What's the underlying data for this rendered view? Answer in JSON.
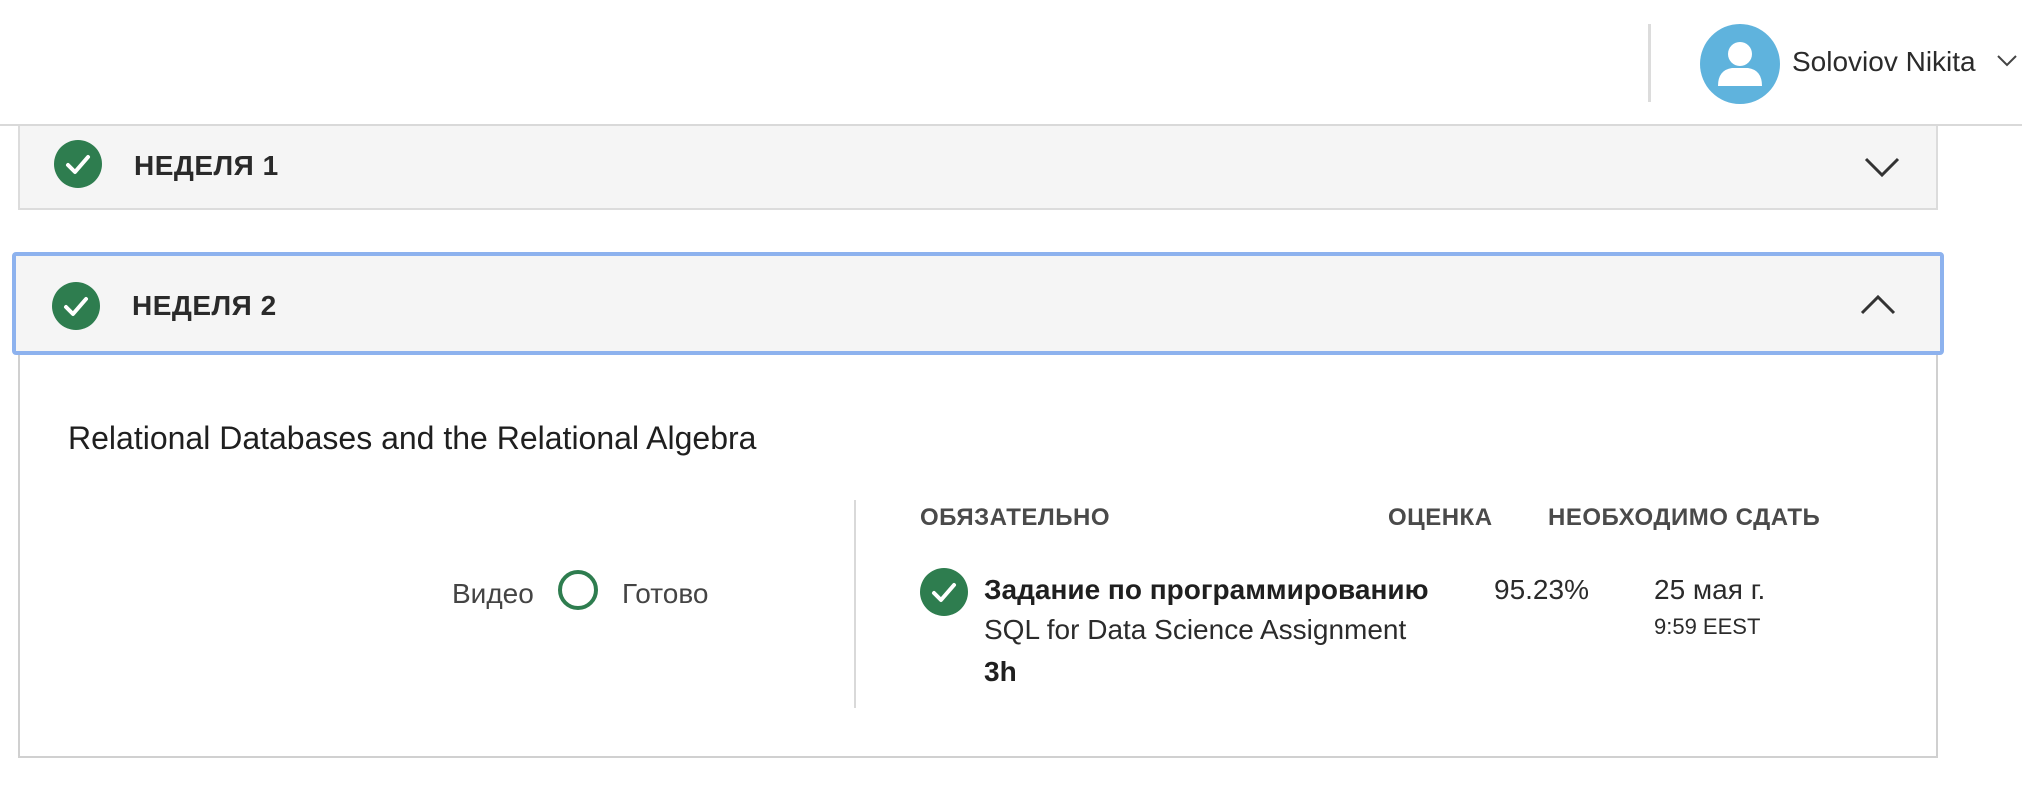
{
  "header": {
    "user_name": "Soloviov Nikita",
    "avatar_color": "#5fb3dd"
  },
  "weeks": [
    {
      "title": "НЕДЕЛЯ 1",
      "completed": true,
      "expanded": false
    },
    {
      "title": "НЕДЕЛЯ 2",
      "completed": true,
      "expanded": true
    }
  ],
  "module": {
    "title": "Relational Databases and the Relational Algebra",
    "progress": {
      "label_left": "Видео",
      "label_right": "Готово"
    },
    "columns": {
      "required": "ОБЯЗАТЕЛЬНО",
      "grade": "ОЦЕНКА",
      "due": "НЕОБХОДИМО СДАТЬ"
    },
    "items": [
      {
        "type": "Задание по программированию",
        "name": "SQL for Data Science Assignment",
        "duration": "3h",
        "grade": "95.23%",
        "due_date": "25 мая г.",
        "due_time": "9:59 EEST",
        "completed": true
      }
    ]
  },
  "colors": {
    "accent_green": "#2e7d4f",
    "focus_blue": "#8db2ee",
    "panel_bg": "#f5f5f5"
  }
}
